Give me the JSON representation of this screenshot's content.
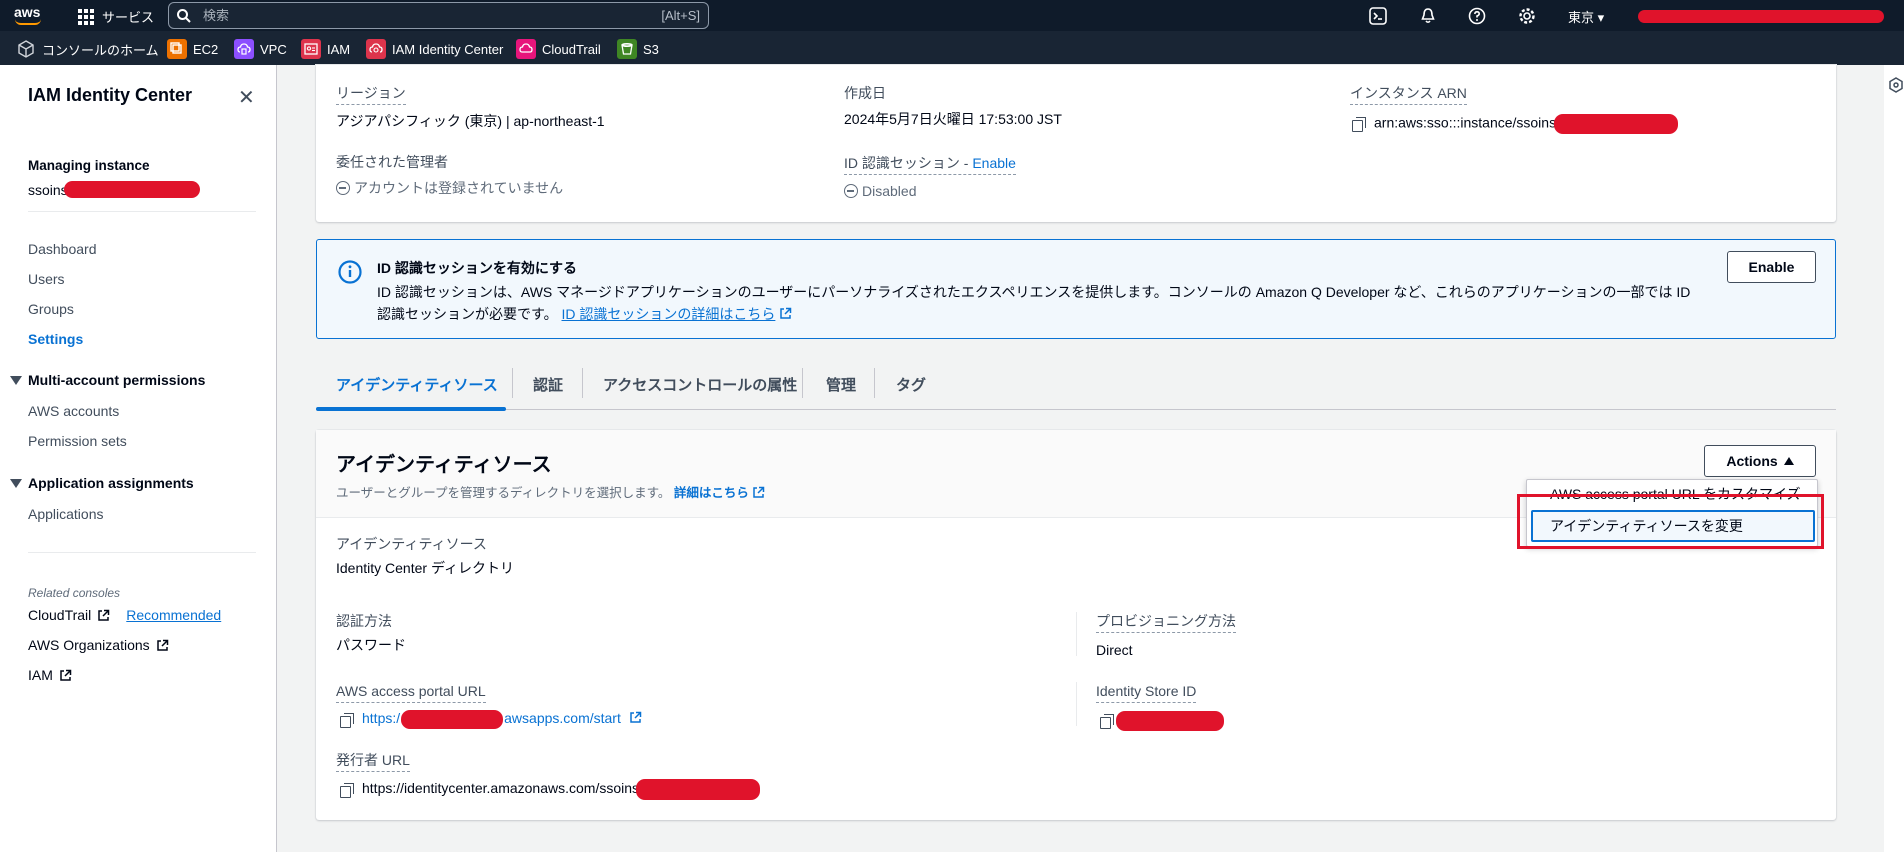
{
  "topbar": {
    "logo_text": "aws",
    "services_label": "サービス",
    "search_placeholder": "検索",
    "search_shortcut": "[Alt+S]",
    "region": "東京 ▾"
  },
  "favorites": [
    {
      "label": "コンソールのホーム",
      "icon": "cube-icon",
      "color": "#414d5c"
    },
    {
      "label": "EC2",
      "icon": "ec2-icon",
      "color": "#ed7100"
    },
    {
      "label": "VPC",
      "icon": "vpc-icon",
      "color": "#8c4fff"
    },
    {
      "label": "IAM",
      "icon": "iam-icon",
      "color": "#dd344c"
    },
    {
      "label": "IAM Identity Center",
      "icon": "identity-center-icon",
      "color": "#dd344c"
    },
    {
      "label": "CloudTrail",
      "icon": "cloudtrail-icon",
      "color": "#e7157b"
    },
    {
      "label": "S3",
      "icon": "s3-icon",
      "color": "#3f8624"
    }
  ],
  "sidebar": {
    "title": "IAM Identity Center",
    "managing_label": "Managing instance",
    "managing_value": "ssoins",
    "items": [
      "Dashboard",
      "Users",
      "Groups",
      "Settings"
    ],
    "active": "Settings",
    "multi_account_heading": "Multi-account permissions",
    "multi_account_items": [
      "AWS accounts",
      "Permission sets"
    ],
    "app_heading": "Application assignments",
    "app_items": [
      "Applications"
    ],
    "related_title": "Related consoles",
    "related": [
      {
        "label": "CloudTrail",
        "badge": "Recommended"
      },
      {
        "label": "AWS Organizations"
      },
      {
        "label": "IAM"
      }
    ]
  },
  "details": {
    "region_label": "リージョン",
    "region_value": "アジアパシフィック (東京) | ap-northeast-1",
    "created_label": "作成日",
    "created_value": "2024年5月7日火曜日 17:53:00 JST",
    "arn_label": "インスタンス ARN",
    "arn_value": "arn:aws:sso:::instance/ssoins",
    "delegated_label": "委任された管理者",
    "delegated_value": "アカウントは登録されていません",
    "session_label": "ID 認識セッション - ",
    "session_link": "Enable",
    "session_value": "Disabled"
  },
  "alert": {
    "title": "ID 認識セッションを有効にする",
    "body_line1": "ID 認識セッションは、AWS マネージドアプリケーションのユーザーにパーソナライズされたエクスペリエンスを提供します。コンソールの Amazon Q Developer など、これらのアプリケーションの一部では ID",
    "body_line2": "認識セッションが必要です。",
    "link": "ID 認識セッションの詳細はこちら",
    "button": "Enable"
  },
  "tabs": [
    "アイデンティティソース",
    "認証",
    "アクセスコントロールの属性",
    "管理",
    "タグ"
  ],
  "identity_source": {
    "title": "アイデンティティソース",
    "description": "ユーザーとグループを管理するディレクトリを選択します。",
    "learn_more": "詳細はこちら",
    "actions_label": "Actions",
    "actions_menu": [
      "AWS access portal URL をカスタマイズ",
      "アイデンティティソースを変更"
    ],
    "source_label": "アイデンティティソース",
    "source_value": "Identity Center ディレクトリ",
    "auth_label": "認証方法",
    "auth_value": "パスワード",
    "provisioning_label": "プロビジョニング方法",
    "provisioning_value": "Direct",
    "portal_label": "AWS access portal URL",
    "portal_prefix": "https:/",
    "portal_suffix": "awsapps.com/start",
    "store_label": "Identity Store ID",
    "issuer_label": "発行者 URL",
    "issuer_value": "https://identitycenter.amazonaws.com/ssoins"
  }
}
